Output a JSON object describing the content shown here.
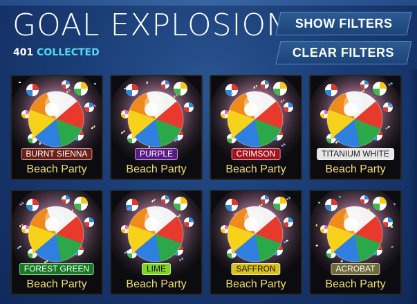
{
  "header": {
    "title": "GOAL EXPLOSION",
    "collected_count": "401",
    "collected_label": "COLLECTED",
    "show_filters_label": "SHOW FILTERS",
    "clear_filters_label": "CLEAR FILTERS"
  },
  "items": [
    {
      "name": "Beach Party",
      "paint": "BURNT SIENNA",
      "badge_color": "#6e2017",
      "badge_text_color": "#ffffff"
    },
    {
      "name": "Beach Party",
      "paint": "PURPLE",
      "badge_color": "#5a1a86",
      "badge_text_color": "#ffffff"
    },
    {
      "name": "Beach Party",
      "paint": "CRIMSON",
      "badge_color": "#a3131d",
      "badge_text_color": "#ffffff"
    },
    {
      "name": "Beach Party",
      "paint": "TITANIUM WHITE",
      "badge_color": "#e6e6e6",
      "badge_text_color": "#222222"
    },
    {
      "name": "Beach Party",
      "paint": "FOREST GREEN",
      "badge_color": "#167a24",
      "badge_text_color": "#ffffff"
    },
    {
      "name": "Beach Party",
      "paint": "LIME",
      "badge_color": "#7ed321",
      "badge_text_color": "#111111"
    },
    {
      "name": "Beach Party",
      "paint": "SAFFRON",
      "badge_color": "#d8c11a",
      "badge_text_color": "#111111"
    },
    {
      "name": "Beach Party",
      "paint": "ACROBAT",
      "badge_color": "#6f6a3a",
      "badge_text_color": "#ffffff"
    }
  ],
  "colors": {
    "collected_accent": "#56d6f5",
    "item_name": "#f2dc76"
  },
  "icons": {
    "item_art": "beach-ball-explosion-icon"
  }
}
